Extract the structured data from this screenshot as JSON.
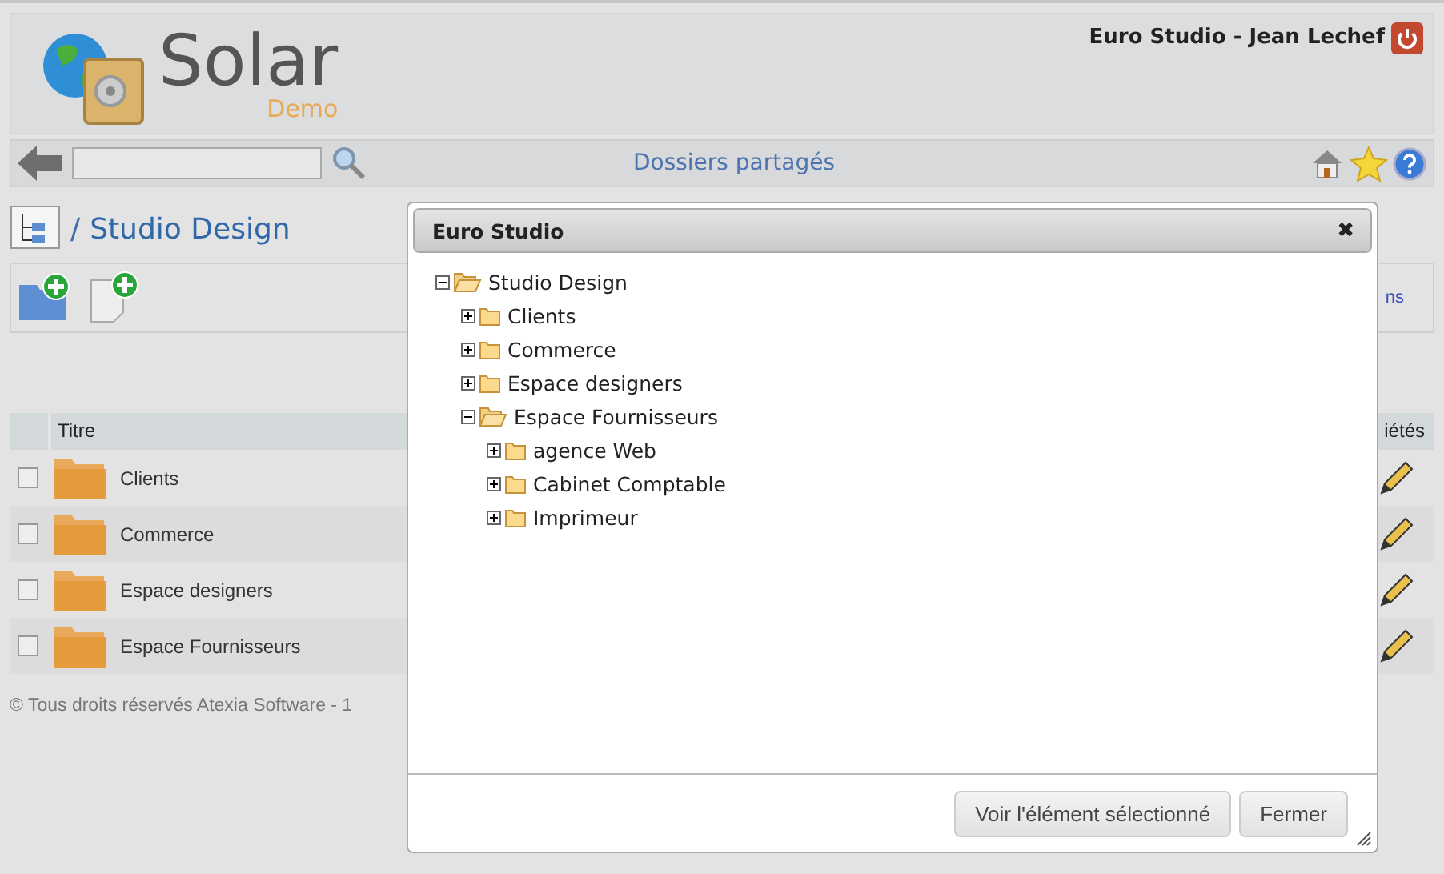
{
  "header": {
    "logo_title": "Solar",
    "logo_subtitle": "Demo",
    "user": "Euro Studio - Jean Lechef"
  },
  "toolbar": {
    "title": "Dossiers partagés"
  },
  "breadcrumb": {
    "separator": "/",
    "title": "Studio Design"
  },
  "actions": {
    "link_partial": "ns"
  },
  "table": {
    "columns": [
      "Titre",
      "iétés"
    ],
    "rows": [
      {
        "title": "Clients",
        "checked": false
      },
      {
        "title": "Commerce",
        "checked": false
      },
      {
        "title": "Espace designers",
        "checked": false
      },
      {
        "title": "Espace Fournisseurs",
        "checked": false
      }
    ]
  },
  "footer": "© Tous droits réservés Atexia Software - 1",
  "dialog": {
    "title": "Euro Studio",
    "close": "✖",
    "tree": [
      {
        "label": "Studio Design",
        "expanded": true,
        "children": [
          {
            "label": "Clients",
            "expanded": false
          },
          {
            "label": "Commerce",
            "expanded": false
          },
          {
            "label": "Espace designers",
            "expanded": false
          },
          {
            "label": "Espace Fournisseurs",
            "expanded": true,
            "children": [
              {
                "label": "agence Web",
                "expanded": false
              },
              {
                "label": "Cabinet Comptable",
                "expanded": false
              },
              {
                "label": "Imprimeur",
                "expanded": false
              }
            ]
          }
        ]
      }
    ],
    "buttons": [
      "Voir l'élément sélectionné",
      "Fermer"
    ]
  }
}
